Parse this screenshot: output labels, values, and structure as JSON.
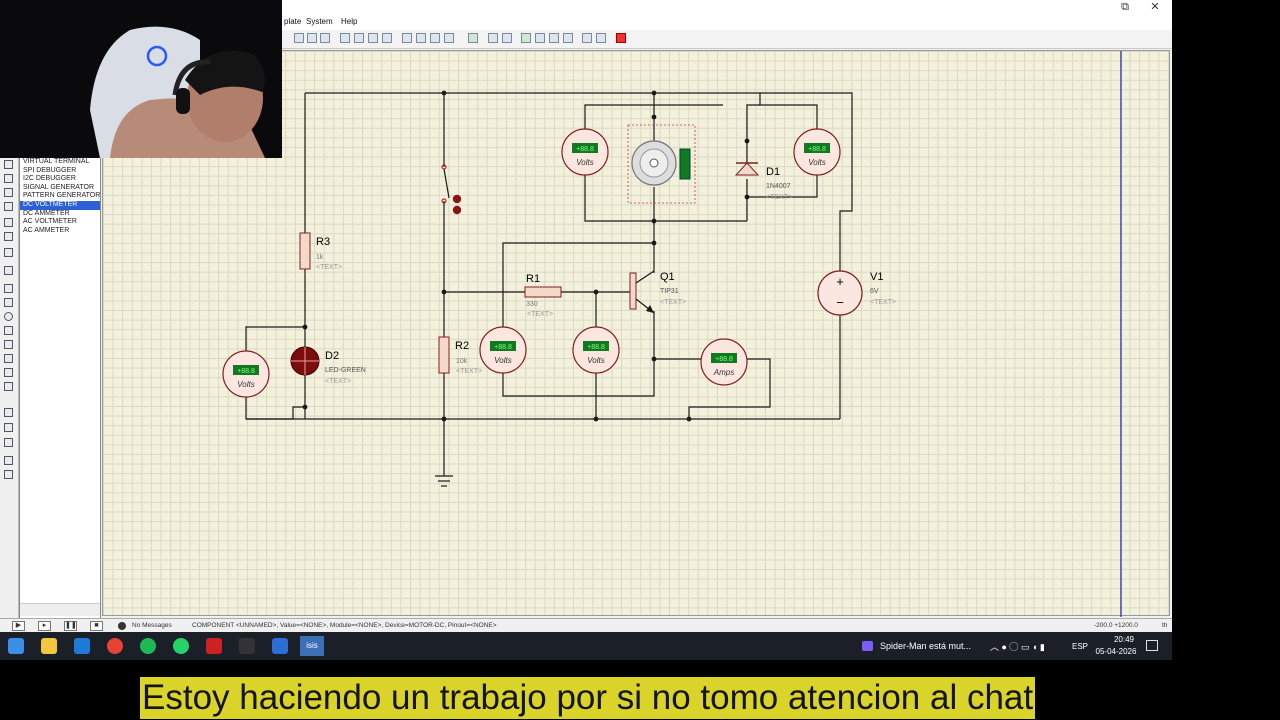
{
  "menu": {
    "partial_item": "plate",
    "system": "System",
    "help": "Help"
  },
  "window": {
    "restore_glyph": "⧉",
    "close_glyph": "✕"
  },
  "devices": [
    "VIRTUAL TERMINAL",
    "SPI DEBUGGER",
    "I2C DEBUGGER",
    "SIGNAL GENERATOR",
    "PATTERN GENERATOR",
    "DC VOLTMETER",
    "DC AMMETER",
    "AC VOLTMETER",
    "AC AMMETER"
  ],
  "selected_device_index": 5,
  "schematic": {
    "r3": {
      "ref": "R3",
      "value": "1k",
      "text": "<TEXT>"
    },
    "r1": {
      "ref": "R1",
      "value": "330",
      "text": "<TEXT>"
    },
    "r2": {
      "ref": "R2",
      "value": "10k",
      "text": "<TEXT>"
    },
    "q1": {
      "ref": "Q1",
      "value": "TIP31",
      "text": "<TEXT>"
    },
    "d1": {
      "ref": "D1",
      "value": "1N4007",
      "text": "<TEXT>"
    },
    "d2": {
      "ref": "D2",
      "value": "LED-GREEN",
      "text": "<TEXT>"
    },
    "v1": {
      "ref": "V1",
      "value": "6V",
      "text": "<TEXT>"
    },
    "meter_volts": "Volts",
    "meter_amps": "Amps",
    "meter_reading": "+88.8",
    "plus": "+",
    "minus": "−"
  },
  "status": {
    "messages": "No Messages",
    "info": "COMPONENT <UNNAMED>, Value=<NONE>, Module=<NONE>, Device=MOTOR-DC, Pinout=<NONE>",
    "coords": "-200.0  +1200.0",
    "units": "th"
  },
  "taskbar": {
    "notification": "Spider-Man está mut...",
    "lang": "ESP",
    "time": "20:49",
    "date": "05-04-2026",
    "active_app": "isis"
  },
  "subtitle": "Estoy haciendo un trabajo por si no tomo atencion al chat",
  "colors": {
    "canvas": "#f3f1dc",
    "wire": "#1a1a1a",
    "meter_body": "#fbe7e0",
    "meter_display": "#0f7a1f",
    "selected": "#2d5fd6",
    "subtitle_bg": "#d9d32a"
  }
}
